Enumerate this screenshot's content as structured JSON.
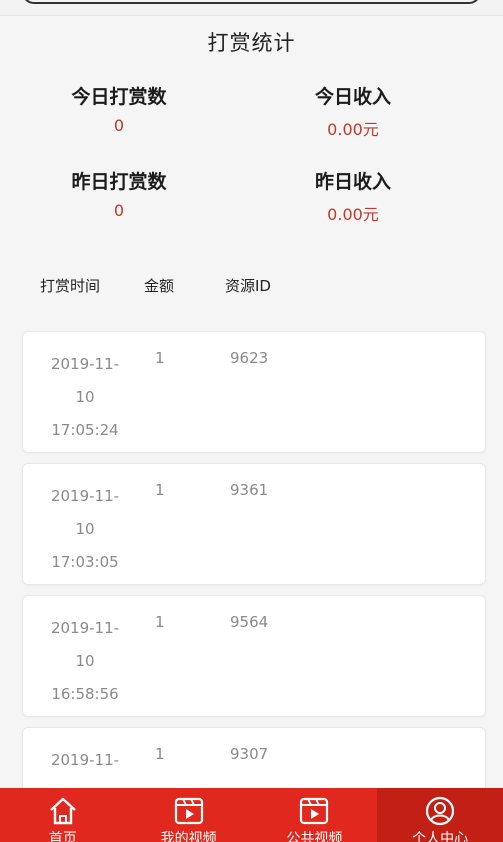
{
  "page": {
    "title": "打赏统计"
  },
  "stats": {
    "today_count_label": "今日打赏数",
    "today_count_value": "0",
    "today_income_label": "今日收入",
    "today_income_value": "0.00元",
    "yesterday_count_label": "昨日打赏数",
    "yesterday_count_value": "0",
    "yesterday_income_label": "昨日收入",
    "yesterday_income_value": "0.00元"
  },
  "table": {
    "headers": [
      "打赏时间",
      "金额",
      "资源ID"
    ],
    "rows": [
      {
        "time_line1": "2019-11-",
        "time_line2": "10",
        "time_line3": "17:05:24",
        "amount": "1",
        "resource_id": "9623"
      },
      {
        "time_line1": "2019-11-",
        "time_line2": "10",
        "time_line3": "17:03:05",
        "amount": "1",
        "resource_id": "9361"
      },
      {
        "time_line1": "2019-11-",
        "time_line2": "10",
        "time_line3": "16:58:56",
        "amount": "1",
        "resource_id": "9564"
      },
      {
        "time_line1": "2019-11-",
        "time_line2": "",
        "time_line3": "",
        "amount": "1",
        "resource_id": "9307"
      }
    ]
  },
  "tabbar": {
    "items": [
      {
        "label": "首页",
        "icon": "home-icon"
      },
      {
        "label": "我的视频",
        "icon": "video-icon"
      },
      {
        "label": "公共视频",
        "icon": "video-icon"
      },
      {
        "label": "个人中心",
        "icon": "user-icon"
      }
    ],
    "active_index": 3,
    "color": "#e0281e",
    "active_color": "#c22015"
  },
  "colors": {
    "accent_value": "#c0392b"
  }
}
